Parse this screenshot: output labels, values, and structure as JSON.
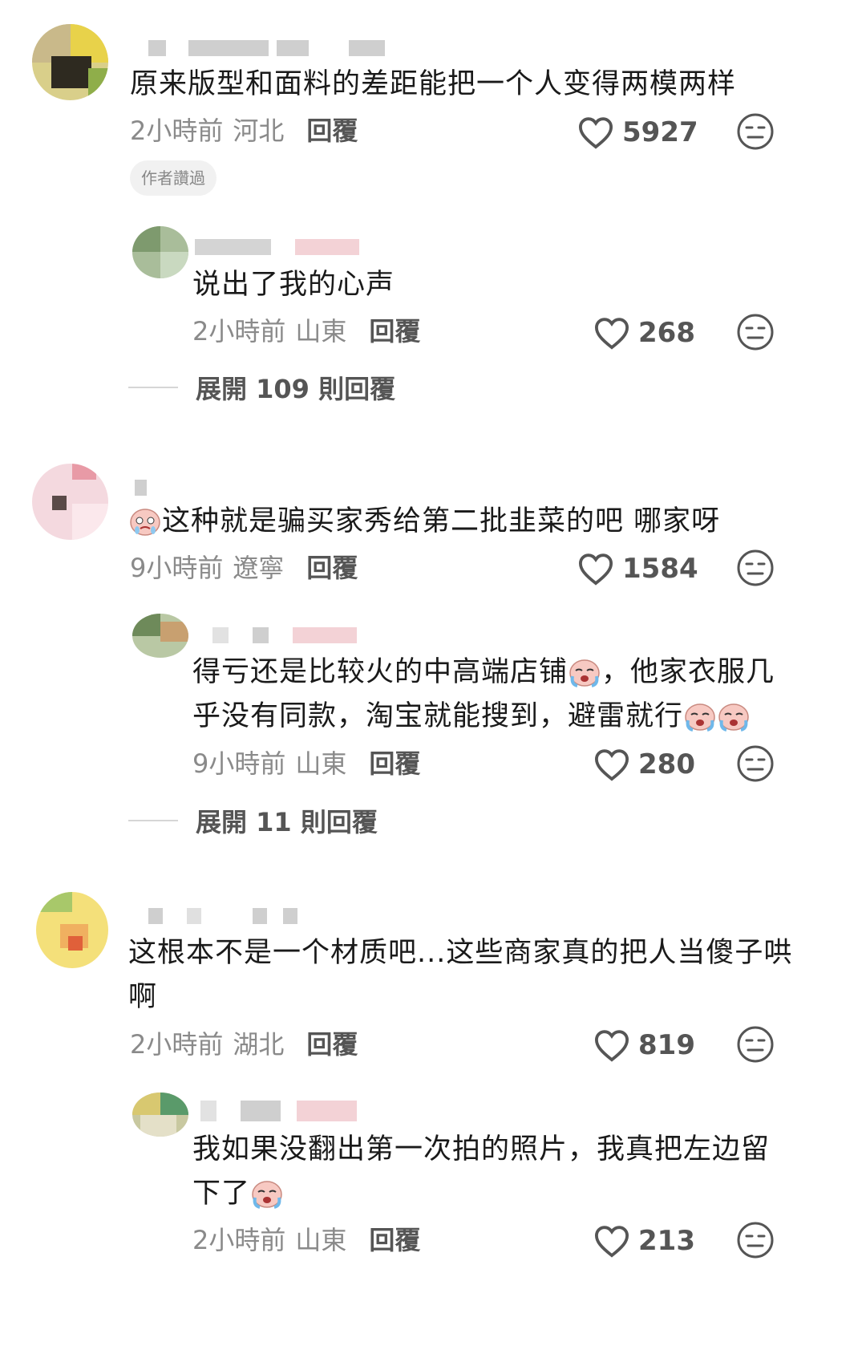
{
  "comments": [
    {
      "text": "原来版型和面料的差距能把一个人变得两模两样",
      "time": "2小時前",
      "location": "河北",
      "reply_label": "回覆",
      "likes": "5927",
      "author_badge": "作者讚過",
      "reply": {
        "text": "说出了我的心声",
        "time": "2小時前",
        "location": "山東",
        "reply_label": "回覆",
        "likes": "268"
      },
      "expand_label": "展開 109 則回覆"
    },
    {
      "text": "这种就是骗买家秀给第二批韭菜的吧 哪家呀",
      "time": "9小時前",
      "location": "遼寧",
      "reply_label": "回覆",
      "likes": "1584",
      "reply": {
        "text_line1": "得亏还是比较火的中高端店铺",
        "text_line1b": "，他家衣服几",
        "text_line2": "乎没有同款，淘宝就能搜到，避雷就行",
        "time": "9小時前",
        "location": "山東",
        "reply_label": "回覆",
        "likes": "280"
      },
      "expand_label": "展開 11 則回覆"
    },
    {
      "text_line1": "这根本不是一个材质吧...这些商家真的把人当傻子哄",
      "text_line2": "啊",
      "time": "2小時前",
      "location": "湖北",
      "reply_label": "回覆",
      "likes": "819",
      "reply": {
        "text_line1": "我如果没翻出第一次拍的照片，我真把左边留",
        "text_line2": "下了",
        "time": "2小時前",
        "location": "山東",
        "reply_label": "回覆",
        "likes": "213"
      }
    }
  ],
  "colors": {
    "text": "#1a1a1a",
    "meta": "#8a8a8a",
    "icon": "#555555"
  },
  "icons": [
    "heart-icon",
    "emoji-face-icon"
  ]
}
